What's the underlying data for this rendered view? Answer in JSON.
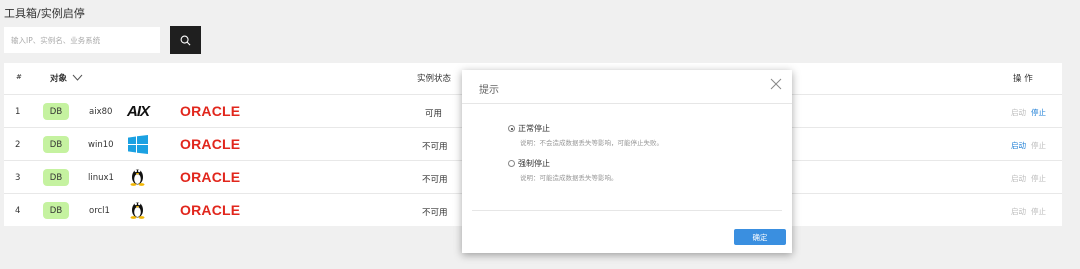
{
  "breadcrumb": "工具箱/实例启停",
  "search": {
    "placeholder": "输入IP、实例名、业务系统"
  },
  "table": {
    "headers": {
      "index": "#",
      "object": "对象",
      "status": "实例状态",
      "actions": "操 作"
    },
    "rows": [
      {
        "index": "1",
        "type": "DB",
        "name": "aix80",
        "os": "aix",
        "db": "ORACLE",
        "status": "可用",
        "start": "启动",
        "stop": "停止",
        "active": "stop"
      },
      {
        "index": "2",
        "type": "DB",
        "name": "win10",
        "os": "windows",
        "db": "ORACLE",
        "status": "不可用",
        "start": "启动",
        "stop": "停止",
        "active": "start"
      },
      {
        "index": "3",
        "type": "DB",
        "name": "linux1",
        "os": "linux",
        "db": "ORACLE",
        "status": "不可用",
        "start": "启动",
        "stop": "停止",
        "active": "none"
      },
      {
        "index": "4",
        "type": "DB",
        "name": "orcl1",
        "os": "linux",
        "db": "ORACLE",
        "status": "不可用",
        "start": "启动",
        "stop": "停止",
        "active": "none"
      }
    ]
  },
  "dialog": {
    "title": "提示",
    "options": [
      {
        "label": "正常停止",
        "desc": "说明：不会造成数据丢失等影响，可能停止失败。",
        "checked": true
      },
      {
        "label": "强制停止",
        "desc": "说明：可能造成数据丢失等影响。",
        "checked": false
      }
    ],
    "confirm": "确定"
  },
  "logos": {
    "aix": "AIX"
  },
  "colors": {
    "accent": "#1c7ed6",
    "badge": "#c5f2a0",
    "oracle": "#e1261c",
    "confirm": "#3a8fe0"
  }
}
